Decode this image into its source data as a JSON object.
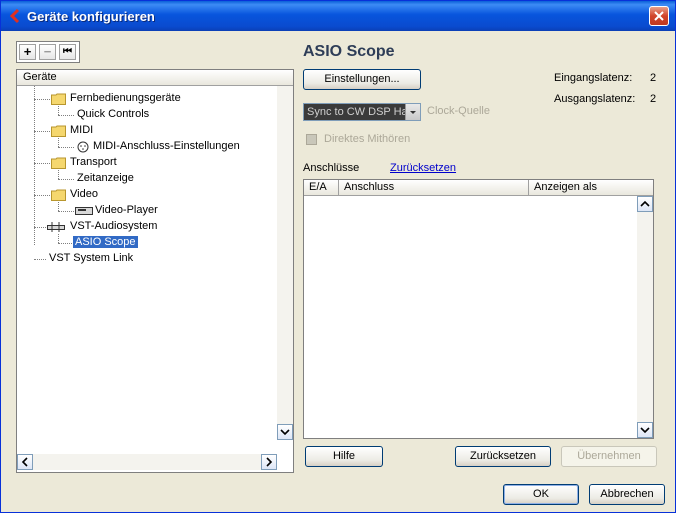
{
  "window": {
    "title": "Geräte konfigurieren",
    "accent": "#0a4bcf"
  },
  "toolbar": {
    "add": "+",
    "remove": "−",
    "reset": "⏮"
  },
  "tree": {
    "header": "Geräte",
    "items": [
      {
        "label": "Fernbedienungsgeräte"
      },
      {
        "label": "Quick Controls"
      },
      {
        "label": "MIDI"
      },
      {
        "label": "MIDI-Anschluss-Einstellungen"
      },
      {
        "label": "Transport"
      },
      {
        "label": "Zeitanzeige"
      },
      {
        "label": "Video"
      },
      {
        "label": "Video-Player"
      },
      {
        "label": "VST-Audiosystem"
      },
      {
        "label": "ASIO Scope"
      },
      {
        "label": "VST System Link"
      }
    ],
    "selected": "ASIO Scope"
  },
  "panel": {
    "heading": "ASIO Scope",
    "settings_button": "Einstellungen...",
    "input_latency_label": "Eingangslatenz:",
    "input_latency_value": "2",
    "output_latency_label": "Ausgangslatenz:",
    "output_latency_value": "2",
    "clock_source_value": "Sync to CW DSP Har",
    "clock_source_label": "Clock-Quelle",
    "direct_monitoring_label": "Direktes Mithören",
    "ports_label": "Anschlüsse",
    "reset_link": "Zurücksetzen",
    "columns": [
      "E/A",
      "Anschluss",
      "Anzeigen als"
    ]
  },
  "buttons": {
    "help": "Hilfe",
    "reset": "Zurücksetzen",
    "apply": "Übernehmen",
    "ok": "OK",
    "cancel": "Abbrechen"
  }
}
